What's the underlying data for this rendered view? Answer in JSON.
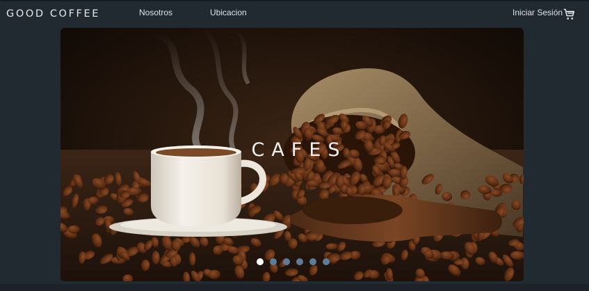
{
  "nav": {
    "brand": "GOOD COFFEE",
    "links": [
      "Nosotros",
      "Ubicacion"
    ],
    "login": "Iniciar Sesión",
    "cart_icon": "cart-icon"
  },
  "carousel": {
    "caption": "CAFES",
    "slide_count": 6,
    "active_slide": 1
  },
  "colors": {
    "page_bg": "#222a31",
    "dot_active": "#ffffff",
    "dot_inactive": "#5f7c96"
  }
}
